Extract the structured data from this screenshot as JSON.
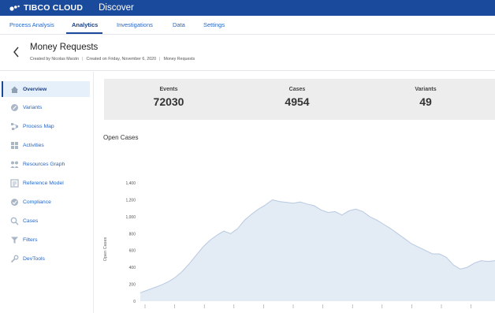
{
  "topbar": {
    "brand": "TIBCO CLOUD",
    "app": "Discover"
  },
  "tabs": [
    "Process Analysis",
    "Analytics",
    "Investigations",
    "Data",
    "Settings"
  ],
  "active_tab": "Analytics",
  "page": {
    "title": "Money Requests",
    "created_by": "Created by Nicolas Marzin",
    "created_on": "Created on Friday, November 6, 2020",
    "dataset": "Money Requests"
  },
  "sidebar": {
    "items": [
      {
        "label": "Overview",
        "icon": "home-icon"
      },
      {
        "label": "Variants",
        "icon": "variants-icon"
      },
      {
        "label": "Process Map",
        "icon": "process-map-icon"
      },
      {
        "label": "Activities",
        "icon": "activities-icon"
      },
      {
        "label": "Resources Graph",
        "icon": "resources-icon"
      },
      {
        "label": "Reference Model",
        "icon": "reference-model-icon"
      },
      {
        "label": "Compliance",
        "icon": "compliance-icon"
      },
      {
        "label": "Cases",
        "icon": "cases-icon"
      },
      {
        "label": "Filters",
        "icon": "filter-icon"
      },
      {
        "label": "DevTools",
        "icon": "wrench-icon"
      }
    ]
  },
  "stats": {
    "events": {
      "label": "Events",
      "value": "72030"
    },
    "cases": {
      "label": "Cases",
      "value": "4954"
    },
    "variants": {
      "label": "Variants",
      "value": "49"
    }
  },
  "colors": {
    "brand": "#1a4a9c",
    "link": "#2566c6",
    "area_fill": "#e3ebf5",
    "area_line": "#b8c9e0"
  },
  "chart_title": "Open Cases",
  "chart_data": {
    "type": "area",
    "ylabel": "Open Cases",
    "yticks": [
      "0",
      "200",
      "400",
      "600",
      "800",
      "1,000",
      "1,200",
      "1,400"
    ],
    "ylim": [
      0,
      1400
    ],
    "x_tick_count": 12,
    "values": [
      100,
      130,
      160,
      190,
      230,
      280,
      350,
      440,
      540,
      640,
      720,
      780,
      830,
      800,
      860,
      960,
      1030,
      1090,
      1140,
      1200,
      1180,
      1170,
      1160,
      1175,
      1150,
      1130,
      1080,
      1050,
      1060,
      1020,
      1070,
      1090,
      1060,
      1000,
      960,
      910,
      860,
      800,
      740,
      680,
      640,
      600,
      560,
      560,
      520,
      430,
      380,
      400,
      450,
      480,
      470,
      480
    ],
    "grid": false
  }
}
